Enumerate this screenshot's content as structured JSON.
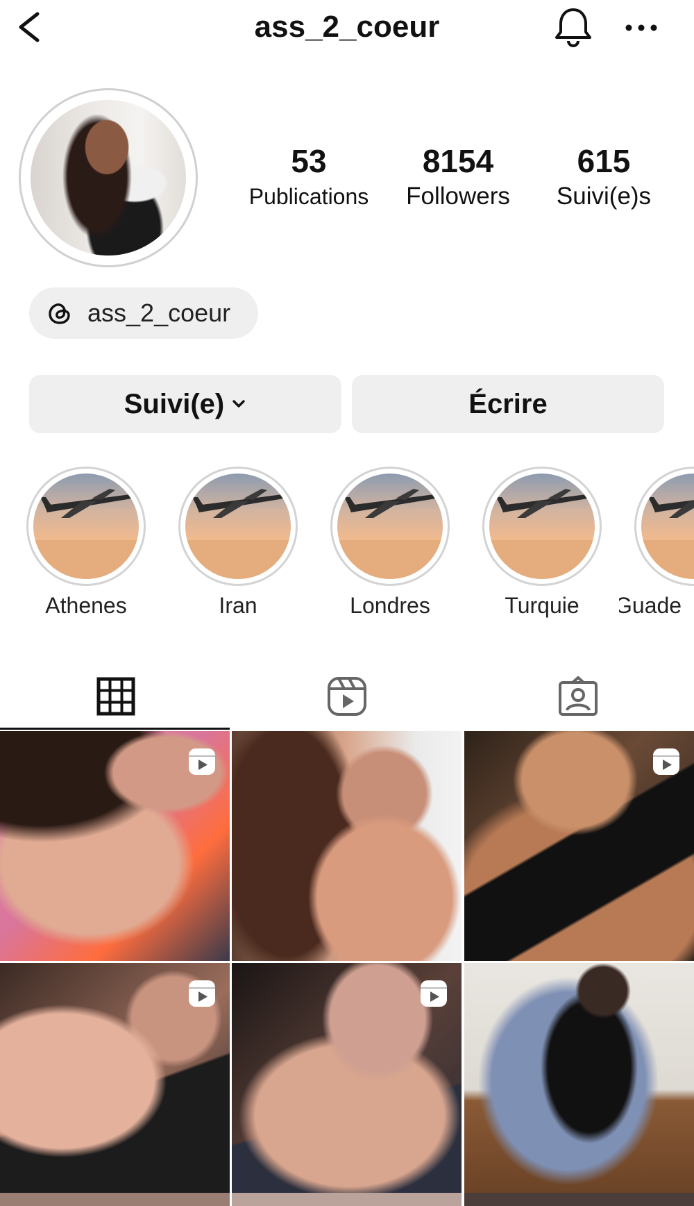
{
  "header": {
    "username": "ass_2_coeur",
    "back_icon": "chevron-left-icon",
    "bell_icon": "bell-icon",
    "more_icon": "more-horizontal-icon"
  },
  "stats": [
    {
      "value": "53",
      "label": "Publications"
    },
    {
      "value": "8154",
      "label": "Followers"
    },
    {
      "value": "615",
      "label": "Suivi(e)s"
    }
  ],
  "threads": {
    "handle": "ass_2_coeur",
    "icon": "threads-icon"
  },
  "actions": {
    "follow_label": "Suivi(e)",
    "message_label": "Écrire"
  },
  "highlights": [
    {
      "label": "Athenes"
    },
    {
      "label": "Iran"
    },
    {
      "label": "Londres"
    },
    {
      "label": "Turquie"
    },
    {
      "label": "Guade"
    }
  ],
  "tabs": [
    {
      "icon": "grid-icon",
      "active": true
    },
    {
      "icon": "reels-icon",
      "active": false
    },
    {
      "icon": "tagged-icon",
      "active": false
    }
  ],
  "posts": [
    {
      "is_reel": true
    },
    {
      "is_reel": false
    },
    {
      "is_reel": true
    },
    {
      "is_reel": true
    },
    {
      "is_reel": true
    },
    {
      "is_reel": false
    }
  ],
  "colors": {
    "accent": "#111111",
    "button_bg": "#efefef",
    "ring": "#d0d0d0"
  }
}
